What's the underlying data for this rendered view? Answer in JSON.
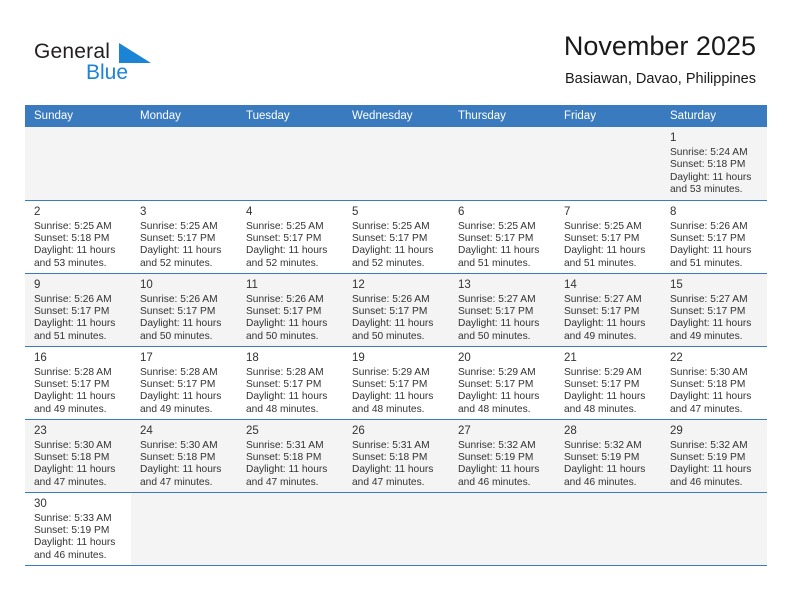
{
  "brand": {
    "name_part1": "General",
    "name_part2": "Blue",
    "flag_color": "#1c84d6",
    "text_color": "#231f20"
  },
  "header": {
    "title": "November 2025",
    "subtitle": "Basiawan, Davao, Philippines"
  },
  "theme": {
    "header_row_bg": "#3a7bbf",
    "header_row_text": "#ffffff",
    "cell_border": "#3a7bbf",
    "shaded_cell_bg": "#f4f4f4",
    "text": "#333333"
  },
  "weekdays": [
    "Sunday",
    "Monday",
    "Tuesday",
    "Wednesday",
    "Thursday",
    "Friday",
    "Saturday"
  ],
  "labels": {
    "sunrise_prefix": "Sunrise:",
    "sunset_prefix": "Sunset:",
    "daylight_prefix": "Daylight:"
  },
  "weeks": [
    [
      {
        "day": "",
        "empty": true,
        "line1": "",
        "line2": "",
        "line3": "",
        "line4": ""
      },
      {
        "day": "",
        "empty": true,
        "line1": "",
        "line2": "",
        "line3": "",
        "line4": ""
      },
      {
        "day": "",
        "empty": true,
        "line1": "",
        "line2": "",
        "line3": "",
        "line4": ""
      },
      {
        "day": "",
        "empty": true,
        "line1": "",
        "line2": "",
        "line3": "",
        "line4": ""
      },
      {
        "day": "",
        "empty": true,
        "line1": "",
        "line2": "",
        "line3": "",
        "line4": ""
      },
      {
        "day": "",
        "empty": true,
        "line1": "",
        "line2": "",
        "line3": "",
        "line4": ""
      },
      {
        "day": "1",
        "empty": false,
        "line1": "Sunrise: 5:24 AM",
        "line2": "Sunset: 5:18 PM",
        "line3": "Daylight: 11 hours",
        "line4": "and 53 minutes."
      }
    ],
    [
      {
        "day": "2",
        "empty": false,
        "line1": "Sunrise: 5:25 AM",
        "line2": "Sunset: 5:18 PM",
        "line3": "Daylight: 11 hours",
        "line4": "and 53 minutes."
      },
      {
        "day": "3",
        "empty": false,
        "line1": "Sunrise: 5:25 AM",
        "line2": "Sunset: 5:17 PM",
        "line3": "Daylight: 11 hours",
        "line4": "and 52 minutes."
      },
      {
        "day": "4",
        "empty": false,
        "line1": "Sunrise: 5:25 AM",
        "line2": "Sunset: 5:17 PM",
        "line3": "Daylight: 11 hours",
        "line4": "and 52 minutes."
      },
      {
        "day": "5",
        "empty": false,
        "line1": "Sunrise: 5:25 AM",
        "line2": "Sunset: 5:17 PM",
        "line3": "Daylight: 11 hours",
        "line4": "and 52 minutes."
      },
      {
        "day": "6",
        "empty": false,
        "line1": "Sunrise: 5:25 AM",
        "line2": "Sunset: 5:17 PM",
        "line3": "Daylight: 11 hours",
        "line4": "and 51 minutes."
      },
      {
        "day": "7",
        "empty": false,
        "line1": "Sunrise: 5:25 AM",
        "line2": "Sunset: 5:17 PM",
        "line3": "Daylight: 11 hours",
        "line4": "and 51 minutes."
      },
      {
        "day": "8",
        "empty": false,
        "line1": "Sunrise: 5:26 AM",
        "line2": "Sunset: 5:17 PM",
        "line3": "Daylight: 11 hours",
        "line4": "and 51 minutes."
      }
    ],
    [
      {
        "day": "9",
        "empty": false,
        "line1": "Sunrise: 5:26 AM",
        "line2": "Sunset: 5:17 PM",
        "line3": "Daylight: 11 hours",
        "line4": "and 51 minutes."
      },
      {
        "day": "10",
        "empty": false,
        "line1": "Sunrise: 5:26 AM",
        "line2": "Sunset: 5:17 PM",
        "line3": "Daylight: 11 hours",
        "line4": "and 50 minutes."
      },
      {
        "day": "11",
        "empty": false,
        "line1": "Sunrise: 5:26 AM",
        "line2": "Sunset: 5:17 PM",
        "line3": "Daylight: 11 hours",
        "line4": "and 50 minutes."
      },
      {
        "day": "12",
        "empty": false,
        "line1": "Sunrise: 5:26 AM",
        "line2": "Sunset: 5:17 PM",
        "line3": "Daylight: 11 hours",
        "line4": "and 50 minutes."
      },
      {
        "day": "13",
        "empty": false,
        "line1": "Sunrise: 5:27 AM",
        "line2": "Sunset: 5:17 PM",
        "line3": "Daylight: 11 hours",
        "line4": "and 50 minutes."
      },
      {
        "day": "14",
        "empty": false,
        "line1": "Sunrise: 5:27 AM",
        "line2": "Sunset: 5:17 PM",
        "line3": "Daylight: 11 hours",
        "line4": "and 49 minutes."
      },
      {
        "day": "15",
        "empty": false,
        "line1": "Sunrise: 5:27 AM",
        "line2": "Sunset: 5:17 PM",
        "line3": "Daylight: 11 hours",
        "line4": "and 49 minutes."
      }
    ],
    [
      {
        "day": "16",
        "empty": false,
        "line1": "Sunrise: 5:28 AM",
        "line2": "Sunset: 5:17 PM",
        "line3": "Daylight: 11 hours",
        "line4": "and 49 minutes."
      },
      {
        "day": "17",
        "empty": false,
        "line1": "Sunrise: 5:28 AM",
        "line2": "Sunset: 5:17 PM",
        "line3": "Daylight: 11 hours",
        "line4": "and 49 minutes."
      },
      {
        "day": "18",
        "empty": false,
        "line1": "Sunrise: 5:28 AM",
        "line2": "Sunset: 5:17 PM",
        "line3": "Daylight: 11 hours",
        "line4": "and 48 minutes."
      },
      {
        "day": "19",
        "empty": false,
        "line1": "Sunrise: 5:29 AM",
        "line2": "Sunset: 5:17 PM",
        "line3": "Daylight: 11 hours",
        "line4": "and 48 minutes."
      },
      {
        "day": "20",
        "empty": false,
        "line1": "Sunrise: 5:29 AM",
        "line2": "Sunset: 5:17 PM",
        "line3": "Daylight: 11 hours",
        "line4": "and 48 minutes."
      },
      {
        "day": "21",
        "empty": false,
        "line1": "Sunrise: 5:29 AM",
        "line2": "Sunset: 5:17 PM",
        "line3": "Daylight: 11 hours",
        "line4": "and 48 minutes."
      },
      {
        "day": "22",
        "empty": false,
        "line1": "Sunrise: 5:30 AM",
        "line2": "Sunset: 5:18 PM",
        "line3": "Daylight: 11 hours",
        "line4": "and 47 minutes."
      }
    ],
    [
      {
        "day": "23",
        "empty": false,
        "line1": "Sunrise: 5:30 AM",
        "line2": "Sunset: 5:18 PM",
        "line3": "Daylight: 11 hours",
        "line4": "and 47 minutes."
      },
      {
        "day": "24",
        "empty": false,
        "line1": "Sunrise: 5:30 AM",
        "line2": "Sunset: 5:18 PM",
        "line3": "Daylight: 11 hours",
        "line4": "and 47 minutes."
      },
      {
        "day": "25",
        "empty": false,
        "line1": "Sunrise: 5:31 AM",
        "line2": "Sunset: 5:18 PM",
        "line3": "Daylight: 11 hours",
        "line4": "and 47 minutes."
      },
      {
        "day": "26",
        "empty": false,
        "line1": "Sunrise: 5:31 AM",
        "line2": "Sunset: 5:18 PM",
        "line3": "Daylight: 11 hours",
        "line4": "and 47 minutes."
      },
      {
        "day": "27",
        "empty": false,
        "line1": "Sunrise: 5:32 AM",
        "line2": "Sunset: 5:19 PM",
        "line3": "Daylight: 11 hours",
        "line4": "and 46 minutes."
      },
      {
        "day": "28",
        "empty": false,
        "line1": "Sunrise: 5:32 AM",
        "line2": "Sunset: 5:19 PM",
        "line3": "Daylight: 11 hours",
        "line4": "and 46 minutes."
      },
      {
        "day": "29",
        "empty": false,
        "line1": "Sunrise: 5:32 AM",
        "line2": "Sunset: 5:19 PM",
        "line3": "Daylight: 11 hours",
        "line4": "and 46 minutes."
      }
    ],
    [
      {
        "day": "30",
        "empty": false,
        "line1": "Sunrise: 5:33 AM",
        "line2": "Sunset: 5:19 PM",
        "line3": "Daylight: 11 hours",
        "line4": "and 46 minutes."
      },
      {
        "day": "",
        "empty": true,
        "line1": "",
        "line2": "",
        "line3": "",
        "line4": ""
      },
      {
        "day": "",
        "empty": true,
        "line1": "",
        "line2": "",
        "line3": "",
        "line4": ""
      },
      {
        "day": "",
        "empty": true,
        "line1": "",
        "line2": "",
        "line3": "",
        "line4": ""
      },
      {
        "day": "",
        "empty": true,
        "line1": "",
        "line2": "",
        "line3": "",
        "line4": ""
      },
      {
        "day": "",
        "empty": true,
        "line1": "",
        "line2": "",
        "line3": "",
        "line4": ""
      },
      {
        "day": "",
        "empty": true,
        "line1": "",
        "line2": "",
        "line3": "",
        "line4": ""
      }
    ]
  ]
}
